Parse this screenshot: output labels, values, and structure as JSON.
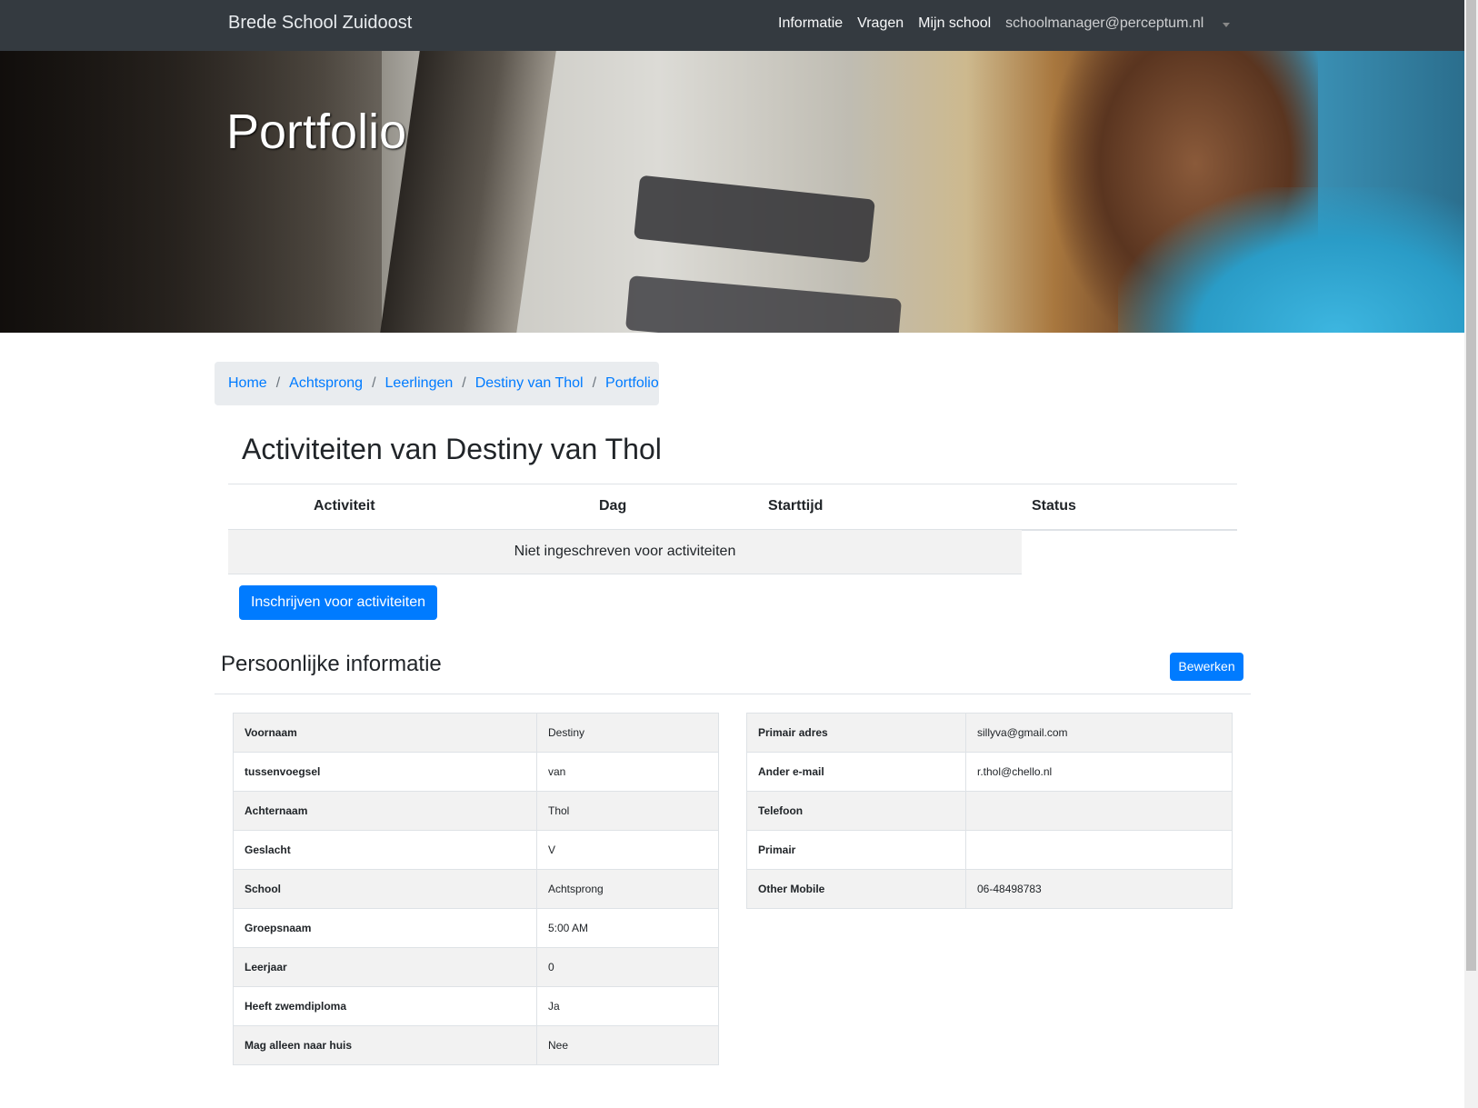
{
  "navbar": {
    "brand": "Brede School Zuidoost",
    "links": [
      "Informatie",
      "Vragen",
      "Mijn school"
    ],
    "user_email": "schoolmanager@perceptum.nl"
  },
  "hero": {
    "title": "Portfolio"
  },
  "breadcrumb": [
    "Home",
    "Achtsprong",
    "Leerlingen",
    "Destiny van Thol",
    "Portfolio"
  ],
  "activities": {
    "title": "Activiteiten van Destiny van Thol",
    "columns": [
      "Activiteit",
      "Dag",
      "Starttijd",
      "Status"
    ],
    "empty_text": "Niet ingeschreven voor activiteiten",
    "enroll_label": "Inschrijven voor activiteiten"
  },
  "personal": {
    "title": "Persoonlijke informatie",
    "edit_label": "Bewerken",
    "left": [
      {
        "label": "Voornaam",
        "value": "Destiny"
      },
      {
        "label": "tussenvoegsel",
        "value": "van"
      },
      {
        "label": "Achternaam",
        "value": "Thol"
      },
      {
        "label": "Geslacht",
        "value": "V"
      },
      {
        "label": "School",
        "value": "Achtsprong"
      },
      {
        "label": "Groepsnaam",
        "value": "5:00 AM"
      },
      {
        "label": "Leerjaar",
        "value": "0"
      },
      {
        "label": "Heeft zwemdiploma",
        "value": "Ja"
      },
      {
        "label": "Mag alleen naar huis",
        "value": "Nee"
      }
    ],
    "right": [
      {
        "label": "Primair adres",
        "value": "sillyva@gmail.com"
      },
      {
        "label": "Ander e-mail",
        "value": "r.thol@chello.nl"
      },
      {
        "label": "Telefoon",
        "value": ""
      },
      {
        "label": "Primair",
        "value": ""
      },
      {
        "label": "Other Mobile",
        "value": "06-48498783"
      }
    ]
  },
  "colors": {
    "navbar": "#343a40",
    "primary": "#007bff",
    "breadcrumb_bg": "#e9ecef"
  }
}
